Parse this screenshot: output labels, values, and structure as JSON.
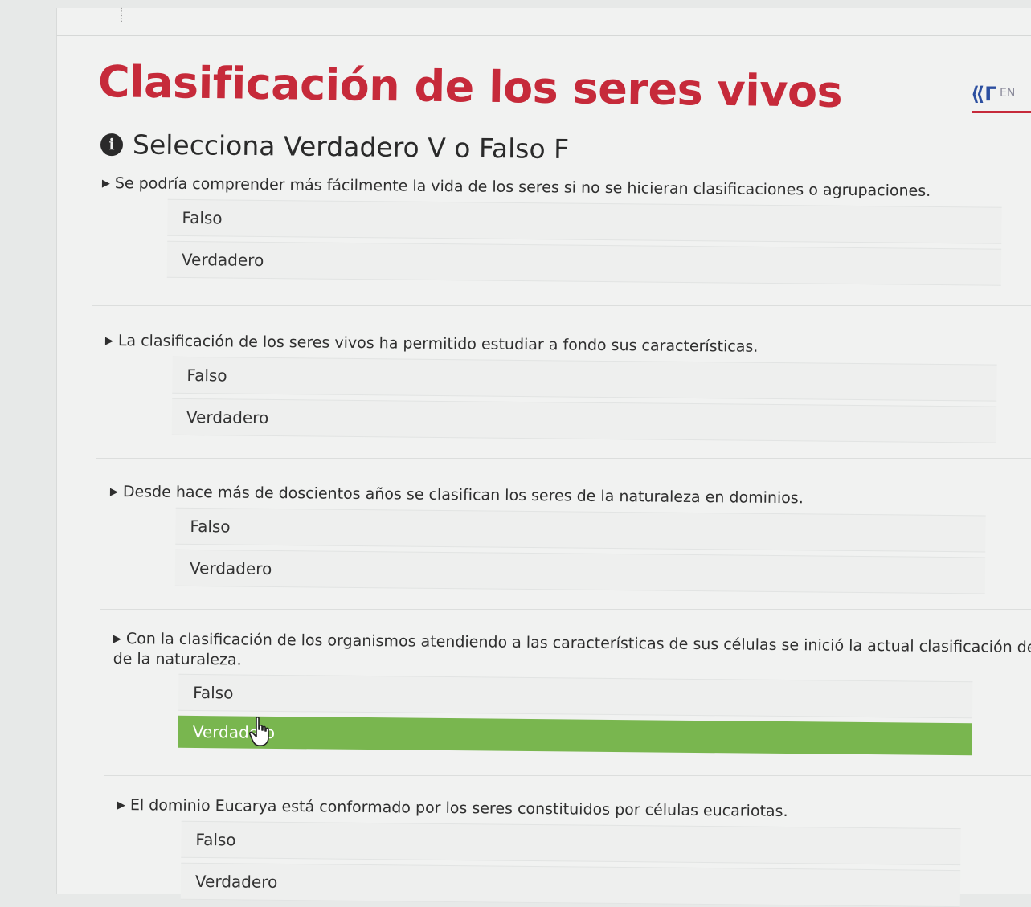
{
  "header": {
    "title": "Clasificación de los seres vivos",
    "subtitle_icon": "info-circle-icon",
    "subtitle": "Selecciona Verdadero V o Falso F",
    "logo_text": "EN"
  },
  "questions": [
    {
      "text": "Se podría comprender más fácilmente la vida de los seres si no se hicieran clasificaciones o agrupaciones.",
      "continuation": "",
      "options": [
        {
          "label": "Falso",
          "selected": false
        },
        {
          "label": "Verdadero",
          "selected": false
        }
      ]
    },
    {
      "text": "La clasificación de los seres vivos ha permitido estudiar a fondo sus características.",
      "continuation": "",
      "options": [
        {
          "label": "Falso",
          "selected": false
        },
        {
          "label": "Verdadero",
          "selected": false
        }
      ]
    },
    {
      "text": "Desde hace más de doscientos años se clasifican los seres de la naturaleza en dominios.",
      "continuation": "",
      "options": [
        {
          "label": "Falso",
          "selected": false
        },
        {
          "label": "Verdadero",
          "selected": false
        }
      ]
    },
    {
      "text": "Con la clasificación de los organismos atendiendo a las características de sus células se inició la actual clasificación de ser",
      "continuation": "de la naturaleza.",
      "options": [
        {
          "label": "Falso",
          "selected": false
        },
        {
          "label": "Verdadero",
          "selected": true
        }
      ]
    },
    {
      "text": "El dominio Eucarya está conformado por los seres constituidos por células eucariotas.",
      "continuation": "",
      "options": [
        {
          "label": "Falso",
          "selected": false
        },
        {
          "label": "Verdadero",
          "selected": false
        }
      ]
    }
  ],
  "colors": {
    "title": "#c62a3a",
    "selected_option": "#79b64f",
    "background": "#f1f2f1"
  }
}
